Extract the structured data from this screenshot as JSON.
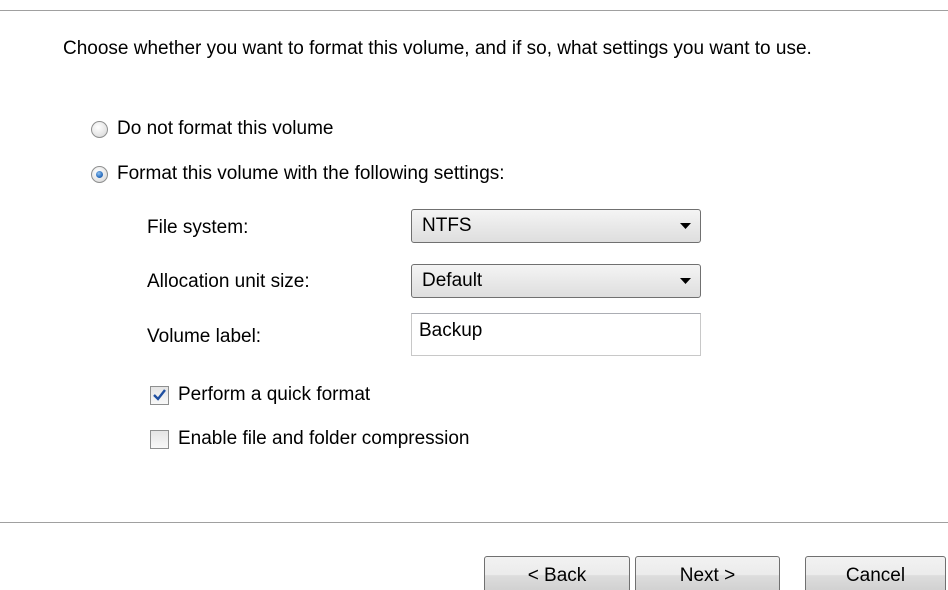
{
  "instruction": "Choose whether you want to format this volume, and if so, what settings you want to use.",
  "options": {
    "no_format_label": "Do not format this volume",
    "no_format_selected": false,
    "format_label": "Format this volume with the following settings:",
    "format_selected": true
  },
  "settings": {
    "file_system_label": "File system:",
    "file_system_value": "NTFS",
    "allocation_label": "Allocation unit size:",
    "allocation_value": "Default",
    "volume_label_label": "Volume label:",
    "volume_label_value": "Backup"
  },
  "checkboxes": {
    "quick_format_label": "Perform a quick format",
    "quick_format_checked": true,
    "compression_label": "Enable file and folder compression",
    "compression_checked": false
  },
  "buttons": {
    "back": "< Back",
    "next": "Next >",
    "cancel": "Cancel"
  },
  "icons": {
    "dropdown": "chevron-down-icon",
    "check": "checkmark-icon"
  },
  "colors": {
    "radio_dot": "#2c6fbf",
    "checkmark": "#1f4fa0",
    "rule": "#a0a0a0"
  }
}
